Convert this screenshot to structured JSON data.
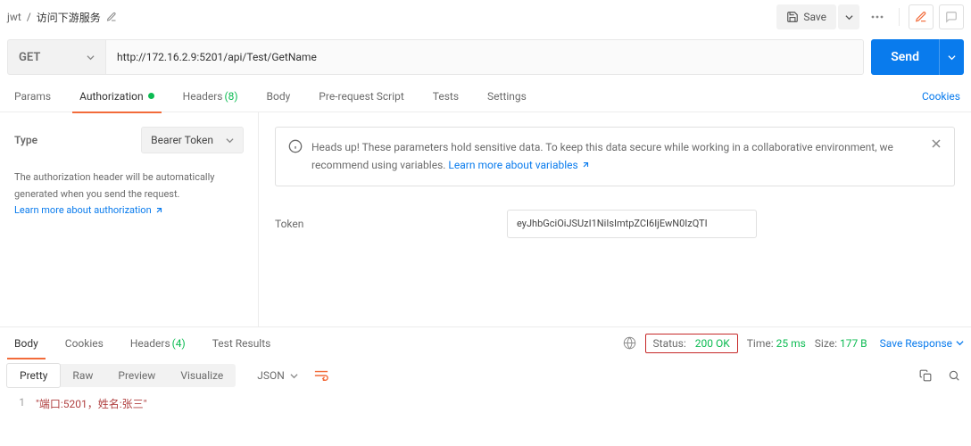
{
  "breadcrumb": {
    "parent": "jwt",
    "sep": "/",
    "current": "访问下游服务"
  },
  "topbar": {
    "save_label": "Save"
  },
  "request": {
    "method": "GET",
    "url": "http://172.16.2.9:5201/api/Test/GetName",
    "send_label": "Send"
  },
  "req_tabs": {
    "params": "Params",
    "authorization": "Authorization",
    "headers": "Headers",
    "headers_count": "(8)",
    "body": "Body",
    "prerequest": "Pre-request Script",
    "tests": "Tests",
    "settings": "Settings",
    "cookies": "Cookies"
  },
  "auth": {
    "type_label": "Type",
    "type_value": "Bearer Token",
    "desc_line": "The authorization header will be automatically generated when you send the request.",
    "learn_auth": "Learn more about authorization",
    "alert_text": "Heads up! These parameters hold sensitive data. To keep this data secure while working in a collaborative environment, we recommend using variables.",
    "learn_vars": "Learn more about variables",
    "token_label": "Token",
    "token_value": "eyJhbGciOiJSUzI1NiIsImtpZCI6IjEwN0IzQTI"
  },
  "resp_tabs": {
    "body": "Body",
    "cookies": "Cookies",
    "headers": "Headers",
    "headers_count": "(4)",
    "test_results": "Test Results"
  },
  "response_meta": {
    "status_label": "Status:",
    "status_value": "200 OK",
    "time_label": "Time:",
    "time_value": "25 ms",
    "size_label": "Size:",
    "size_value": "177 B",
    "save_resp": "Save Response"
  },
  "view": {
    "pretty": "Pretty",
    "raw": "Raw",
    "preview": "Preview",
    "visualize": "Visualize",
    "lang": "JSON"
  },
  "code": {
    "line1_num": "1",
    "line1_text": "\"端口:5201，姓名:张三\""
  }
}
